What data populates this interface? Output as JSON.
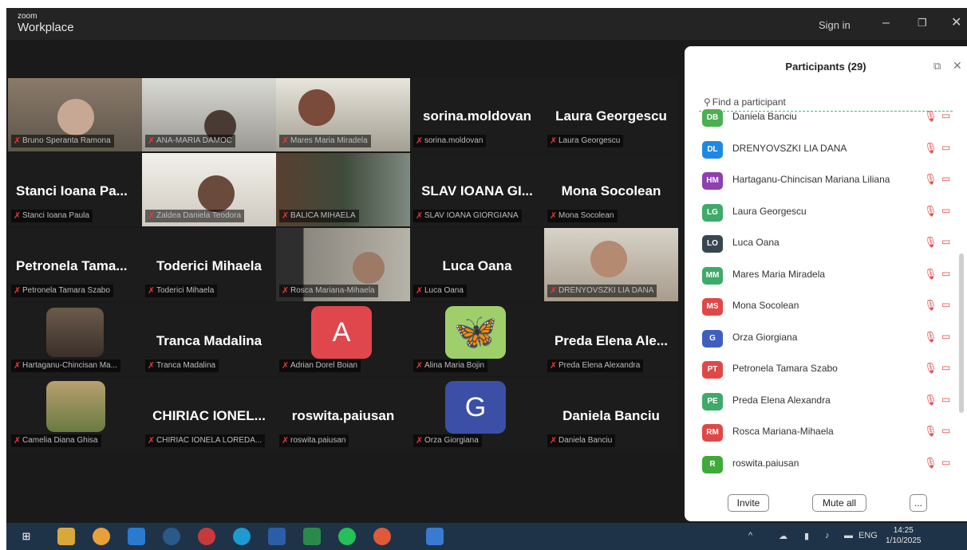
{
  "app": {
    "brand_small": "zoom",
    "brand_title": "Workplace",
    "signin": "Sign in"
  },
  "tiles": {
    "t1_label": "Bruno Speranta Ramona",
    "t2_label": "ANA-MARIA DAMOC",
    "t3_label": "Mares Maria Miradela",
    "t4_name": "sorina.moldovan",
    "t4_label": "sorina.moldovan",
    "t5_name": "Laura Georgescu",
    "t5_label": "Laura Georgescu",
    "t6_name": "Stanci Ioana Pa...",
    "t6_label": "Stanci Ioana Paula",
    "t7_label": "Zaldea Daniela Teodora",
    "t8_label": "BALICA MIHAELA",
    "t9_name": "SLAV IOANA GI...",
    "t9_label": "SLAV IOANA GIORGIANA",
    "t10_name": "Mona Socolean",
    "t10_label": "Mona Socolean",
    "t11_name": "Petronela Tama...",
    "t11_label": "Petronela Tamara Szabo",
    "t12_name": "Toderici Mihaela",
    "t12_label": "Toderici Mihaela",
    "t13_label": "Rosca Mariana-Mihaela",
    "t14_name": "Luca Oana",
    "t14_label": "Luca Oana",
    "t15_label": "DRENYOVSZKI LIA DANA",
    "t16_label": "Hartaganu-Chincisan Ma...",
    "t17_name": "Tranca Madalina",
    "t17_label": "Tranca Madalina",
    "t18_avatar": "A",
    "t18_label": "Adrian Dorel Boian",
    "t19_label": "Alina Maria Bojin",
    "t20_name": "Preda Elena Ale...",
    "t20_label": "Preda Elena Alexandra",
    "t21_label": "Camelia Diana Ghisa",
    "t22_name": "CHIRIAC IONEL...",
    "t22_label": "CHIRIAC IONELA LOREDA...",
    "t23_name": "roswita.paiusan",
    "t23_label": "roswita.paiusan",
    "t24_avatar": "G",
    "t24_label": "Orza Giorgiana",
    "t25_name": "Daniela Banciu",
    "t25_label": "Daniela Banciu"
  },
  "panel": {
    "title": "Participants (29)",
    "search_placeholder": "Find a participant",
    "participants": [
      {
        "initials": "DB",
        "name": "Daniela Banciu",
        "color": "#4caf50"
      },
      {
        "initials": "DL",
        "name": "DRENYOVSZKI LIA DANA",
        "color": "#1e88e5"
      },
      {
        "initials": "HM",
        "name": "Hartaganu-Chincisan Mariana Liliana",
        "color": "#8e3fb0"
      },
      {
        "initials": "LG",
        "name": "Laura Georgescu",
        "color": "#3faa6a"
      },
      {
        "initials": "LO",
        "name": "Luca Oana",
        "color": "#37474f"
      },
      {
        "initials": "MM",
        "name": "Mares Maria Miradela",
        "color": "#3faa6a"
      },
      {
        "initials": "MS",
        "name": "Mona Socolean",
        "color": "#e04848"
      },
      {
        "initials": "G",
        "name": "Orza Giorgiana",
        "color": "#3f5fbf"
      },
      {
        "initials": "PT",
        "name": "Petronela Tamara Szabo",
        "color": "#e04848"
      },
      {
        "initials": "PE",
        "name": "Preda Elena Alexandra",
        "color": "#3faa6a"
      },
      {
        "initials": "RM",
        "name": "Rosca Mariana-Mihaela",
        "color": "#e04848"
      },
      {
        "initials": "R",
        "name": "roswita.paiusan",
        "color": "#3faa3a"
      }
    ],
    "invite": "Invite",
    "mute_all": "Mute all",
    "more": "..."
  },
  "taskbar": {
    "lang": "ENG",
    "time": "14:25",
    "date": "1/10/2025"
  }
}
